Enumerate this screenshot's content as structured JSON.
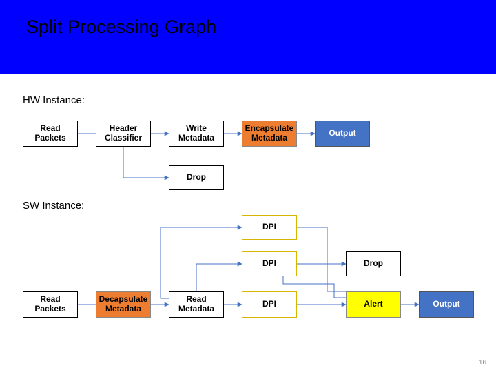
{
  "title": "Split Processing Graph",
  "sections": {
    "hw": "HW Instance:",
    "sw": "SW Instance:"
  },
  "hw_nodes": {
    "read_packets": "Read\nPackets",
    "header_classifier": "Header\nClassifier",
    "write_metadata": "Write\nMetadata",
    "encapsulate_metadata": "Encapsulate\nMetadata",
    "output": "Output",
    "drop": "Drop"
  },
  "sw_nodes": {
    "read_packets": "Read\nPackets",
    "decapsulate_metadata": "Decapsulate\nMetadata",
    "read_metadata": "Read\nMetadata",
    "dpi1": "DPI",
    "dpi2": "DPI",
    "dpi3": "DPI",
    "drop": "Drop",
    "alert": "Alert",
    "output": "Output"
  },
  "page_number": "16"
}
